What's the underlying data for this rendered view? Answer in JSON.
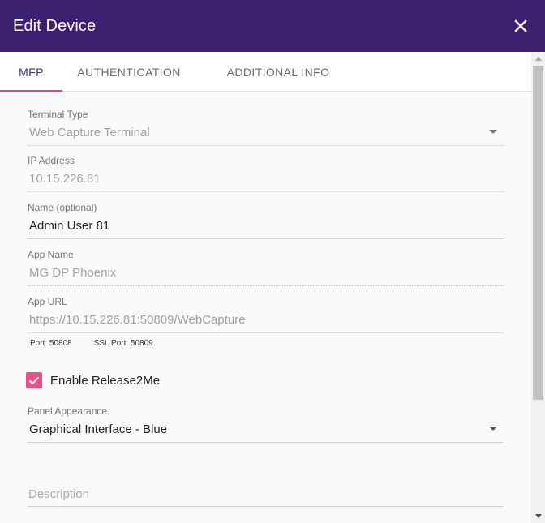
{
  "dialog": {
    "title": "Edit Device",
    "close_icon": "close-icon",
    "header_color": "#3c1f6e"
  },
  "tabs": [
    {
      "label": "MFP",
      "active": true
    },
    {
      "label": "AUTHENTICATION",
      "active": false
    },
    {
      "label": "ADDITIONAL INFO",
      "active": false
    }
  ],
  "form": {
    "terminal_type": {
      "label": "Terminal Type",
      "value": "Web Capture Terminal"
    },
    "ip_address": {
      "label": "IP Address",
      "value": "10.15.226.81"
    },
    "name": {
      "label": "Name (optional)",
      "value": "Admin User 81"
    },
    "app_name": {
      "label": "App Name",
      "value": "MG DP Phoenix"
    },
    "app_url": {
      "label": "App URL",
      "value": "https://10.15.226.81:50809/WebCapture"
    },
    "port": "Port: 50808",
    "ssl_port": "SSL Port: 50809",
    "enable_release2me": {
      "label": "Enable Release2Me",
      "checked": true
    },
    "panel_appearance": {
      "label": "Panel Appearance",
      "value": "Graphical Interface - Blue"
    },
    "description": {
      "placeholder": "Description",
      "value": ""
    }
  },
  "colors": {
    "accent": "#e9518a",
    "tab_active": "#4a2a82"
  }
}
